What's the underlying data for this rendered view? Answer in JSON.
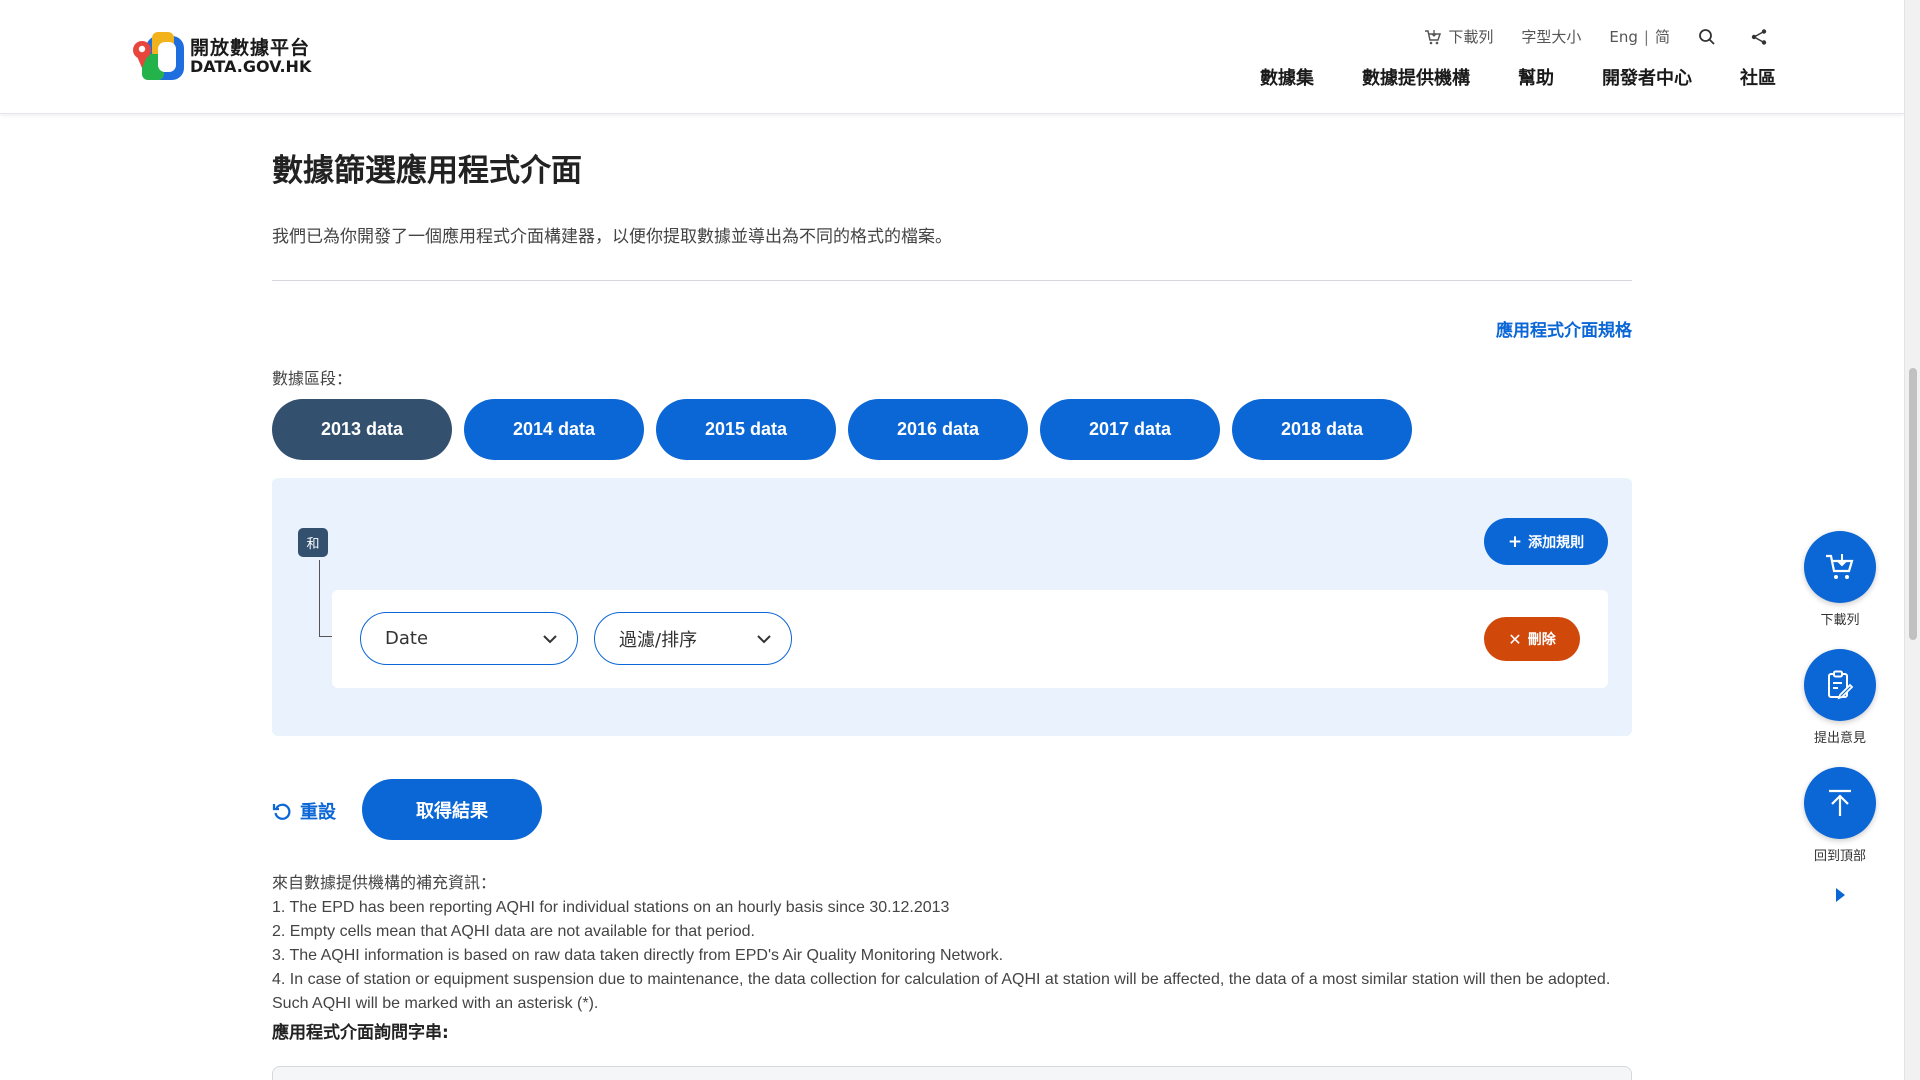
{
  "header": {
    "logo_zh": "開放數據平台",
    "logo_en": "DATA.GOV.HK",
    "util": {
      "download_list": "下載列",
      "font_size": "字型大小",
      "lang_eng": "Eng",
      "lang_sep": "|",
      "lang_simp": "简"
    },
    "nav": [
      "數據集",
      "數據提供機構",
      "幫助",
      "開發者中心",
      "社區"
    ]
  },
  "main": {
    "title": "數據篩選應用程式介面",
    "description": "我們已為你開發了一個應用程式介面構建器，以便你提取數據並導出為不同的格式的檔案。",
    "spec_link": "應用程式介面規格",
    "segment_label": "數據區段：",
    "segments": [
      "2013 data",
      "2014 data",
      "2015 data",
      "2016 data",
      "2017 data",
      "2018 data"
    ],
    "active_segment": "2013 data",
    "rules": {
      "conjunction": "和",
      "add_rule": "添加規則",
      "field_select": "Date",
      "filter_select": "過濾/排序",
      "delete": "刪除"
    },
    "reset": "重設",
    "get_results": "取得結果",
    "notes": [
      "來自數據提供機構的補充資訊：",
      "1. The EPD has been reporting AQHI for individual stations on an hourly basis since 30.12.2013",
      "2. Empty cells mean that AQHI data are not available for that period.",
      "3. The AQHI information is based on raw data taken directly from EPD's Air Quality Monitoring Network.",
      "4. In case of station or equipment suspension due to maintenance, the data collection for calculation of AQHI at station will be affected, the data of a most similar station will then be adopted. Such AQHI will be marked with an asterisk (*)."
    ],
    "query_label": "應用程式介面詢問字串:"
  },
  "floating": {
    "download_list": "下載列",
    "feedback": "提出意見",
    "back_to_top": "回到頂部"
  },
  "colors": {
    "primary": "#0b66d6",
    "active_segment": "#33516f",
    "delete": "#d1480b",
    "panel": "#eaf3fd"
  }
}
